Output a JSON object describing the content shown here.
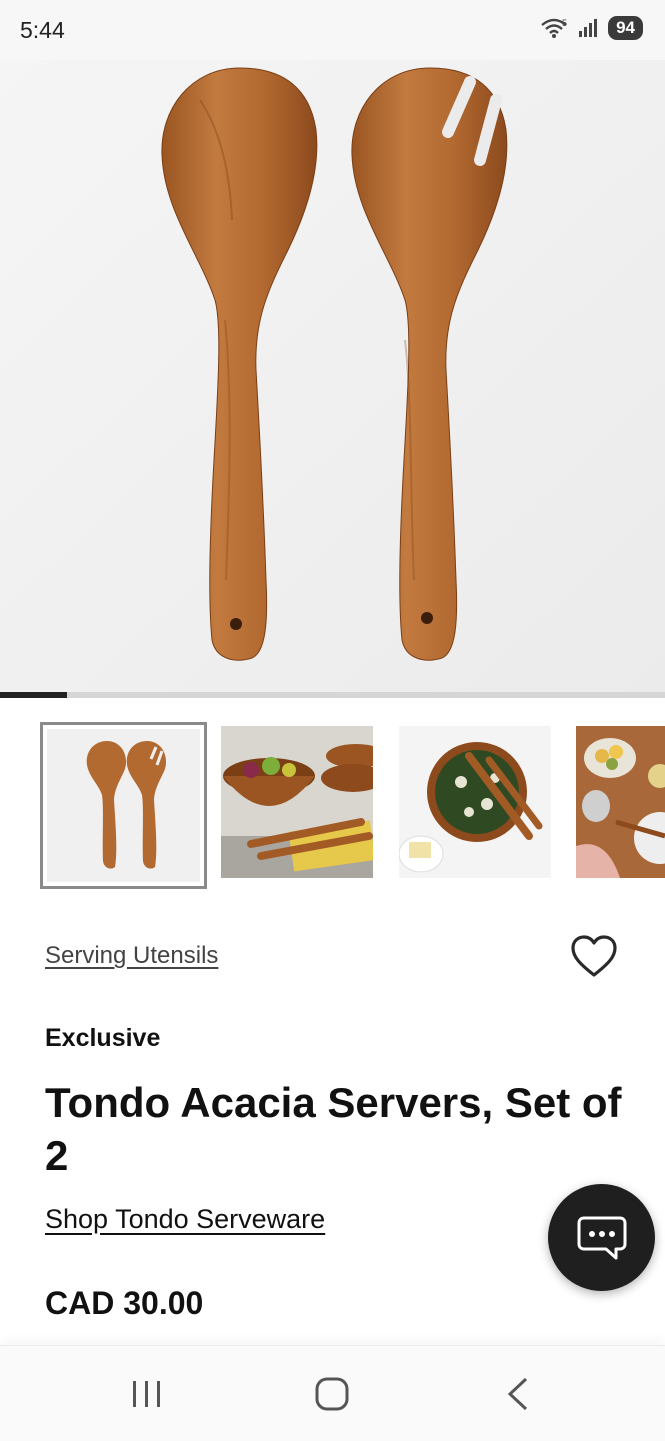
{
  "status_bar": {
    "time": "5:44",
    "battery": "94",
    "wifi_label": "5",
    "icons": [
      "wifi-icon",
      "signal-icon",
      "battery-icon"
    ]
  },
  "gallery": {
    "progress": 0.1,
    "thumbnails": [
      {
        "name": "thumbnail-servers",
        "selected": true
      },
      {
        "name": "thumbnail-bowls-set",
        "selected": false
      },
      {
        "name": "thumbnail-salad-bowl",
        "selected": false
      },
      {
        "name": "thumbnail-table-setting",
        "selected": false
      }
    ]
  },
  "product": {
    "category": "Serving Utensils",
    "tag": "Exclusive",
    "title": "Tondo Acacia Servers, Set of 2",
    "shop_link": "Shop Tondo Serveware",
    "price": "CAD 30.00"
  },
  "colors": {
    "wood": "#b0672f",
    "wood_dark": "#8a4a1c",
    "chat_button": "#1f1f1f",
    "text": "#111111"
  },
  "icons": {
    "favorite": "heart-icon",
    "chat": "chat-icon",
    "nav": [
      "recent-apps-icon",
      "home-icon",
      "back-icon"
    ]
  }
}
